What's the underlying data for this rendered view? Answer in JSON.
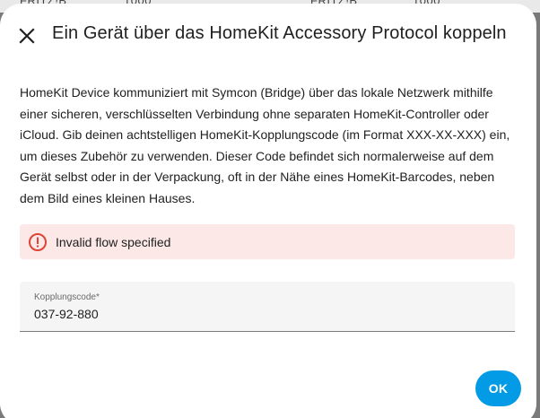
{
  "backdrop": {
    "fragments": [
      "FRITZ!B",
      "1000",
      "FRITZ!B",
      "1000"
    ]
  },
  "dialog": {
    "title": "Ein Gerät über das HomeKit Accessory Protocol koppeln",
    "close_icon": "close-icon",
    "description": "HomeKit Device kommuniziert mit Symcon (Bridge) über das lokale Netzwerk mithilfe einer sicheren, verschlüsselten Verbindung ohne separaten HomeKit-Controller oder iCloud. Gib deinen achtstelligen HomeKit-Kopplungscode (im Format XXX-XX-XXX) ein, um dieses Zubehör zu verwenden. Dieser Code befindet sich normalerweise auf dem Gerät selbst oder in der Verpackung, oft in der Nähe eines HomeKit-Barcodes, neben dem Bild eines kleinen Hauses.",
    "alert": {
      "icon": "alert-circle-icon",
      "text": "Invalid flow specified",
      "color": "#db4437",
      "background": "#fce8e6"
    },
    "field": {
      "label": "Kopplungscode*",
      "value": "037-92-880"
    },
    "ok_label": "OK"
  },
  "colors": {
    "accent": "#039be5"
  }
}
